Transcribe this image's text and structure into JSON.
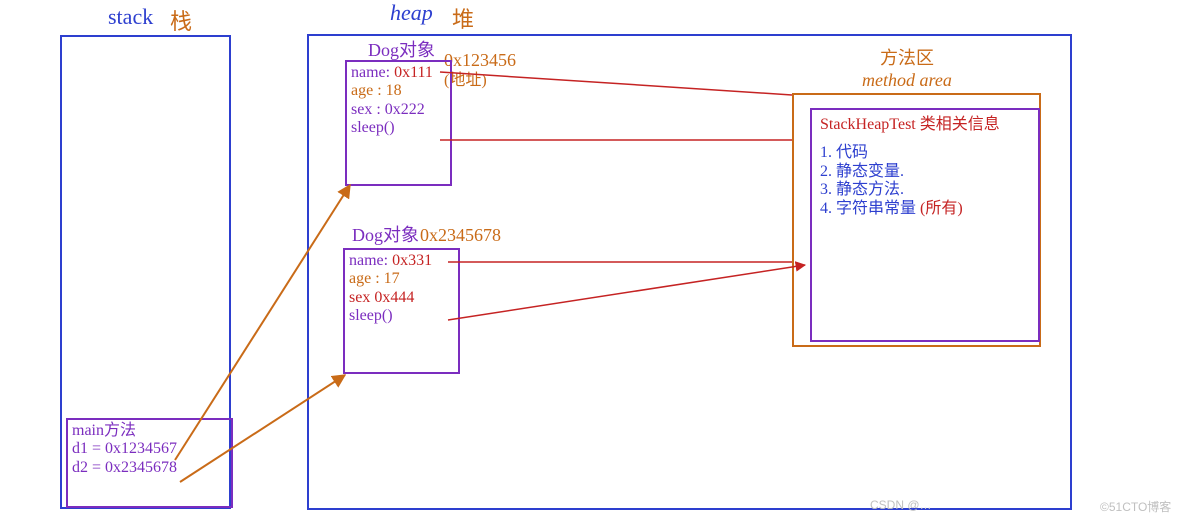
{
  "titles": {
    "stack_en": "stack",
    "stack_zh": "栈",
    "heap_en": "heap",
    "heap_zh": "堆"
  },
  "stack_frame": {
    "label": "main方法",
    "d1": "d1 = 0x1234567",
    "d2": "d2 = 0x2345678"
  },
  "dog1": {
    "title": "Dog对象",
    "addr": "0x123456",
    "addr_note": "(地址)",
    "name": "name: 0x111",
    "age": "age : 18",
    "sex": "sex : 0x222",
    "sleep": "sleep()"
  },
  "dog2": {
    "title": "Dog对象",
    "addr": "0x2345678",
    "name": "name: 0x331",
    "age": "age  : 17",
    "sex": "sex  0x444",
    "sleep": "sleep()"
  },
  "method_area": {
    "title_zh": "方法区",
    "title_en": "method  area",
    "klass": "StackHeapTest 类相关信息",
    "item1": "1. 代码",
    "item2": "2. 静态变量.",
    "item3": "3. 静态方法.",
    "item4": "4. 字符串常量 ",
    "item4_note": "(所有)"
  },
  "watermarks": {
    "csdn": "CSDN @…",
    "cto": "©51CTO博客"
  }
}
